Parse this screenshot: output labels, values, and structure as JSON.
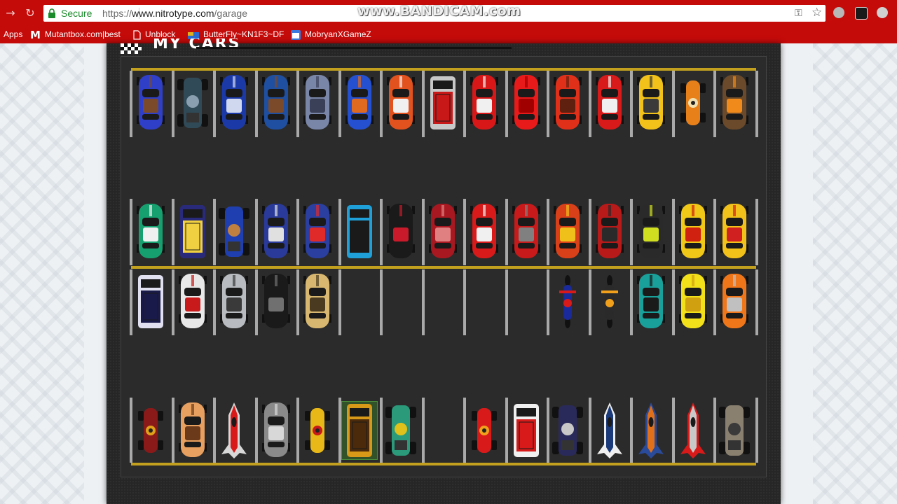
{
  "browser": {
    "secure_label": "Secure",
    "url_prefix": "https://",
    "url_host": "www.nitrotype.com",
    "url_path": "/garage",
    "watermark": "www.BANDICAM.com"
  },
  "bookmarks": [
    {
      "label": "Apps",
      "icon": "apps-icon"
    },
    {
      "label": "Mutantbox.com|best",
      "icon": "mutantbox-icon"
    },
    {
      "label": "Unblock",
      "icon": "page-icon"
    },
    {
      "label": "ButterFly~KN1F3~DF",
      "icon": "butterfly-icon"
    },
    {
      "label": "MobryanXGameZ",
      "icon": "calendar-icon"
    }
  ],
  "section": {
    "title": "MY CARS"
  },
  "colors": {
    "chrome_red": "#c50a0a",
    "lot_line": "#c3a11f",
    "panel": "#262626"
  },
  "garage": {
    "slots": [
      {
        "row": 0,
        "col": 0,
        "color": "#2f3fc8",
        "accent": "#7a4a2a",
        "kind": "car"
      },
      {
        "row": 0,
        "col": 1,
        "color": "#304a58",
        "accent": "#8aa0b0",
        "kind": "buggy"
      },
      {
        "row": 0,
        "col": 2,
        "color": "#1b3aa8",
        "accent": "#d0d8f0",
        "kind": "car"
      },
      {
        "row": 0,
        "col": 3,
        "color": "#1f4fa0",
        "accent": "#7a4a2a",
        "kind": "car"
      },
      {
        "row": 0,
        "col": 4,
        "color": "#7a86a8",
        "accent": "#3a4058",
        "kind": "car"
      },
      {
        "row": 0,
        "col": 5,
        "color": "#2550d0",
        "accent": "#e06a20",
        "kind": "car"
      },
      {
        "row": 0,
        "col": 6,
        "color": "#e2521e",
        "accent": "#f0f0f0",
        "kind": "car"
      },
      {
        "row": 0,
        "col": 7,
        "color": "#c8c8c8",
        "accent": "#c81818",
        "kind": "truck"
      },
      {
        "row": 0,
        "col": 8,
        "color": "#d81818",
        "accent": "#f0f0f0",
        "kind": "car"
      },
      {
        "row": 0,
        "col": 9,
        "color": "#e81a1a",
        "accent": "#a00000",
        "kind": "car"
      },
      {
        "row": 0,
        "col": 10,
        "color": "#e0301a",
        "accent": "#602010",
        "kind": "car"
      },
      {
        "row": 0,
        "col": 11,
        "color": "#d81a1a",
        "accent": "#f0f0f0",
        "kind": "car"
      },
      {
        "row": 0,
        "col": 12,
        "color": "#f2c21a",
        "accent": "#3a3a3a",
        "kind": "car"
      },
      {
        "row": 0,
        "col": 13,
        "color": "#e8801a",
        "accent": "#f0e0b0",
        "kind": "kart"
      },
      {
        "row": 0,
        "col": 14,
        "color": "#6a4a2a",
        "accent": "#f08a1a",
        "kind": "car"
      },
      {
        "row": 1,
        "col": 0,
        "color": "#16a070",
        "accent": "#f0f0f0",
        "kind": "car"
      },
      {
        "row": 1,
        "col": 1,
        "color": "#2a2a7a",
        "accent": "#f0d040",
        "kind": "truck"
      },
      {
        "row": 1,
        "col": 2,
        "color": "#1f3fb0",
        "accent": "#c08040",
        "kind": "buggy"
      },
      {
        "row": 1,
        "col": 3,
        "color": "#2a3a9a",
        "accent": "#e0e0e0",
        "kind": "car"
      },
      {
        "row": 1,
        "col": 4,
        "color": "#2a3fa0",
        "accent": "#e02a2a",
        "kind": "car"
      },
      {
        "row": 1,
        "col": 5,
        "color": "#1fa0d8",
        "accent": "#1a1a1a",
        "kind": "truck"
      },
      {
        "row": 1,
        "col": 6,
        "color": "#1a1a1a",
        "accent": "#c81a2a",
        "kind": "car"
      },
      {
        "row": 1,
        "col": 7,
        "color": "#a81820",
        "accent": "#e08080",
        "kind": "car"
      },
      {
        "row": 1,
        "col": 8,
        "color": "#d81a1a",
        "accent": "#f0f0f0",
        "kind": "car"
      },
      {
        "row": 1,
        "col": 9,
        "color": "#c81a1a",
        "accent": "#808080",
        "kind": "car"
      },
      {
        "row": 1,
        "col": 10,
        "color": "#d8401a",
        "accent": "#f0c01a",
        "kind": "car"
      },
      {
        "row": 1,
        "col": 11,
        "color": "#b81a1a",
        "accent": "#2a2a2a",
        "kind": "car"
      },
      {
        "row": 1,
        "col": 12,
        "color": "#2a2a2a",
        "accent": "#d0e020",
        "kind": "car"
      },
      {
        "row": 1,
        "col": 13,
        "color": "#f0c818",
        "accent": "#d02010",
        "kind": "car"
      },
      {
        "row": 1,
        "col": 14,
        "color": "#f2c21a",
        "accent": "#d02020",
        "kind": "car"
      },
      {
        "row": 2,
        "col": 0,
        "color": "#e0e0f0",
        "accent": "#1a1a4a",
        "kind": "truck"
      },
      {
        "row": 2,
        "col": 1,
        "color": "#e8e8e8",
        "accent": "#c81a1a",
        "kind": "car"
      },
      {
        "row": 2,
        "col": 2,
        "color": "#b8bcc0",
        "accent": "#3a3a3a",
        "kind": "car"
      },
      {
        "row": 2,
        "col": 3,
        "color": "#1a1a1a",
        "accent": "#707070",
        "kind": "car"
      },
      {
        "row": 2,
        "col": 4,
        "color": "#d8b870",
        "accent": "#4a3a20",
        "kind": "car"
      },
      {
        "row": 2,
        "col": 10,
        "color": "#1a2a9a",
        "accent": "#d81a1a",
        "kind": "bike"
      },
      {
        "row": 2,
        "col": 11,
        "color": "#2a2a2a",
        "accent": "#f0a01a",
        "kind": "bike"
      },
      {
        "row": 2,
        "col": 12,
        "color": "#1aa09a",
        "accent": "#1a1a1a",
        "kind": "car"
      },
      {
        "row": 2,
        "col": 13,
        "color": "#f2e01a",
        "accent": "#d0a010",
        "kind": "car"
      },
      {
        "row": 2,
        "col": 14,
        "color": "#f0761a",
        "accent": "#c0c0c0",
        "kind": "car"
      },
      {
        "row": 3,
        "col": 0,
        "color": "#8a1a1a",
        "accent": "#e0a01a",
        "kind": "kart"
      },
      {
        "row": 3,
        "col": 1,
        "color": "#e8a060",
        "accent": "#6a3a1a",
        "kind": "car"
      },
      {
        "row": 3,
        "col": 2,
        "color": "#d81a1a",
        "accent": "#d8d8d8",
        "kind": "rocket"
      },
      {
        "row": 3,
        "col": 3,
        "color": "#8a8a8a",
        "accent": "#d8d8d8",
        "kind": "car"
      },
      {
        "row": 3,
        "col": 4,
        "color": "#e8b818",
        "accent": "#c81a1a",
        "kind": "kart"
      },
      {
        "row": 3,
        "col": 5,
        "color": "#d89818",
        "accent": "#4a2a0a",
        "kind": "truck",
        "selected": true
      },
      {
        "row": 3,
        "col": 6,
        "color": "#2a9a7a",
        "accent": "#e0c01a",
        "kind": "buggy"
      },
      {
        "row": 3,
        "col": 8,
        "color": "#d81a1a",
        "accent": "#f0a01a",
        "kind": "kart"
      },
      {
        "row": 3,
        "col": 9,
        "color": "#f0f0f0",
        "accent": "#d81a1a",
        "kind": "truck"
      },
      {
        "row": 3,
        "col": 10,
        "color": "#2a2a5a",
        "accent": "#c8c8c8",
        "kind": "buggy"
      },
      {
        "row": 3,
        "col": 11,
        "color": "#1a3a7a",
        "accent": "#f0f0f0",
        "kind": "rocket"
      },
      {
        "row": 3,
        "col": 12,
        "color": "#e0701a",
        "accent": "#2a4a9a",
        "kind": "rocket"
      },
      {
        "row": 3,
        "col": 13,
        "color": "#c8c8c8",
        "accent": "#d81a1a",
        "kind": "rocket"
      },
      {
        "row": 3,
        "col": 14,
        "color": "#8a8070",
        "accent": "#3a3a3a",
        "kind": "buggy"
      }
    ]
  }
}
